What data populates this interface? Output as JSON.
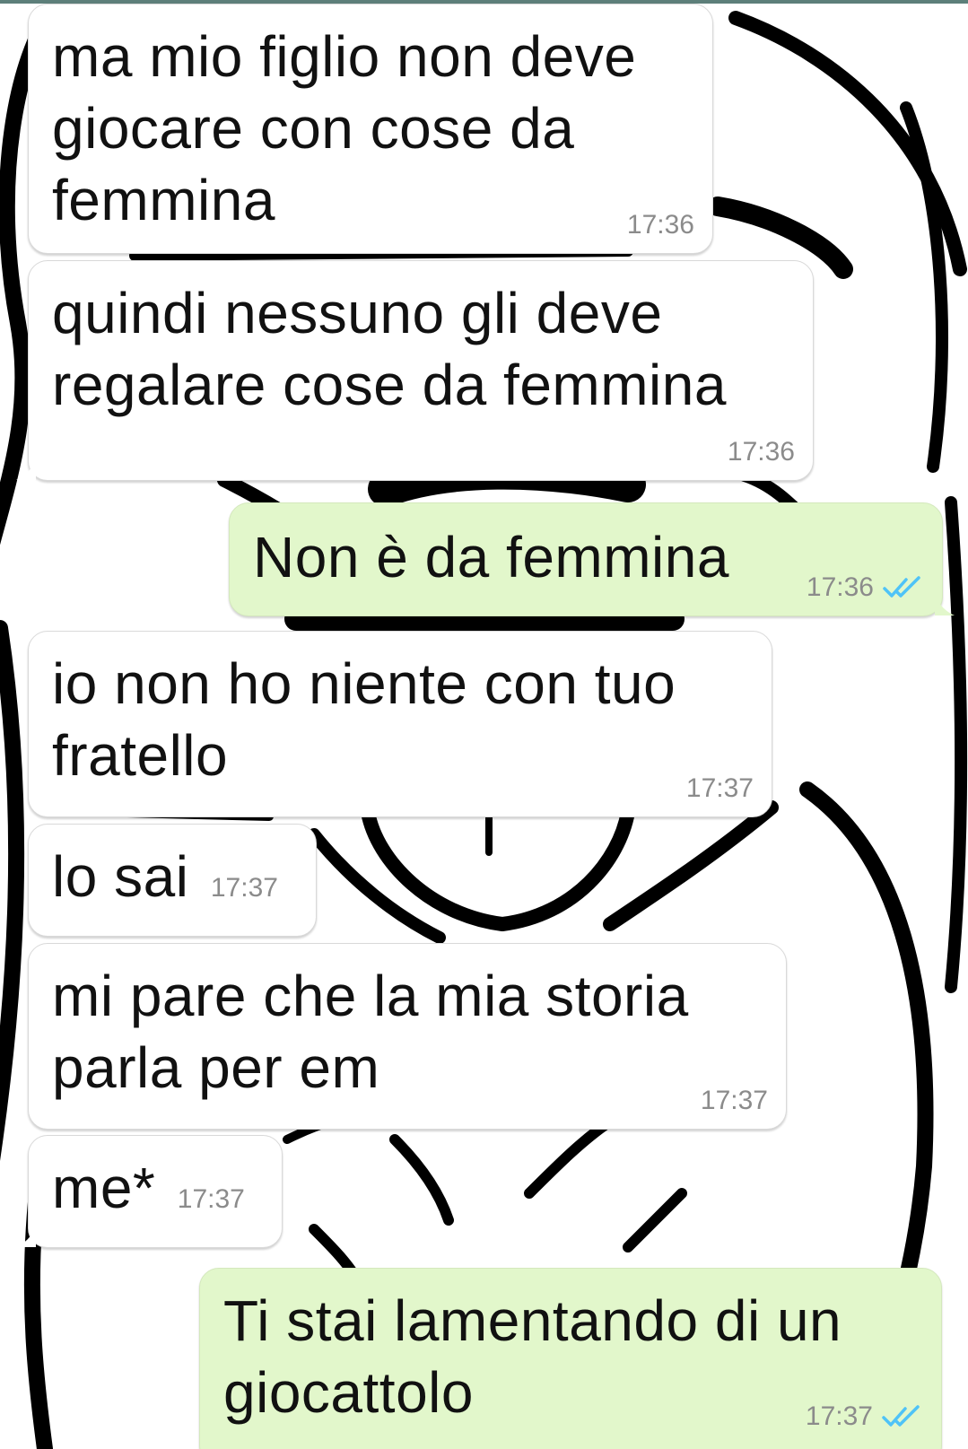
{
  "app": {
    "wallpaper_icon": "cartoon-face-wallpaper",
    "colors": {
      "incoming_bubble": "#ffffff",
      "outgoing_bubble": "#e2f7cb",
      "read_ticks": "#4fc3f7",
      "top_strip": "#5d7f7a"
    }
  },
  "messages": [
    {
      "direction": "in",
      "text": "ma mio figlio non deve\ngiocare con cose da\nfemmina",
      "time": "17:36"
    },
    {
      "direction": "in",
      "text": "quindi nessuno gli deve\nregalare cose da femmina",
      "time": "17:36"
    },
    {
      "direction": "out",
      "text": "Non è da femmina",
      "time": "17:36",
      "status_icon": "double-check-icon"
    },
    {
      "direction": "in",
      "text": "io non ho niente con tuo\nfratello",
      "time": "17:37"
    },
    {
      "direction": "in",
      "text": "lo sai",
      "time": "17:37"
    },
    {
      "direction": "in",
      "text": "mi pare che la mia storia\nparla per em",
      "time": "17:37"
    },
    {
      "direction": "in",
      "text": "me*",
      "time": "17:37"
    },
    {
      "direction": "out",
      "text": "Ti stai lamentando di un\ngiocattolo",
      "time": "17:37",
      "status_icon": "double-check-icon"
    }
  ]
}
